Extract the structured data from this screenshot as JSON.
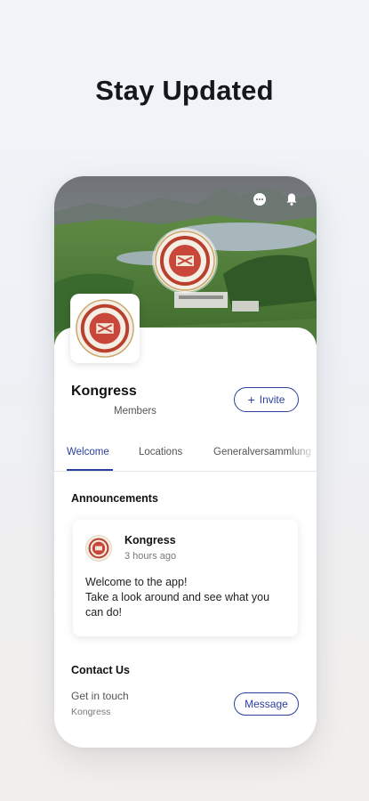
{
  "headline": "Stay Updated",
  "group": {
    "name": "Kongress",
    "members_label": "Members",
    "invite_label": "Invite"
  },
  "tabs": [
    {
      "label": "Welcome",
      "active": true
    },
    {
      "label": "Locations",
      "active": false
    },
    {
      "label": "Generalversammlung",
      "active": false
    }
  ],
  "announcements": {
    "title": "Announcements",
    "post": {
      "author": "Kongress",
      "time": "3 hours ago",
      "line1": "Welcome to the app!",
      "line2": "Take a look around and see what you can do!"
    }
  },
  "contact": {
    "title": "Contact Us",
    "subtitle": "Get in touch",
    "org": "Kongress",
    "message_label": "Message"
  },
  "icons": {
    "chat": "chat-icon",
    "bell": "bell-icon"
  },
  "colors": {
    "accent": "#2b3f9f",
    "background": "#f1f4f8"
  }
}
